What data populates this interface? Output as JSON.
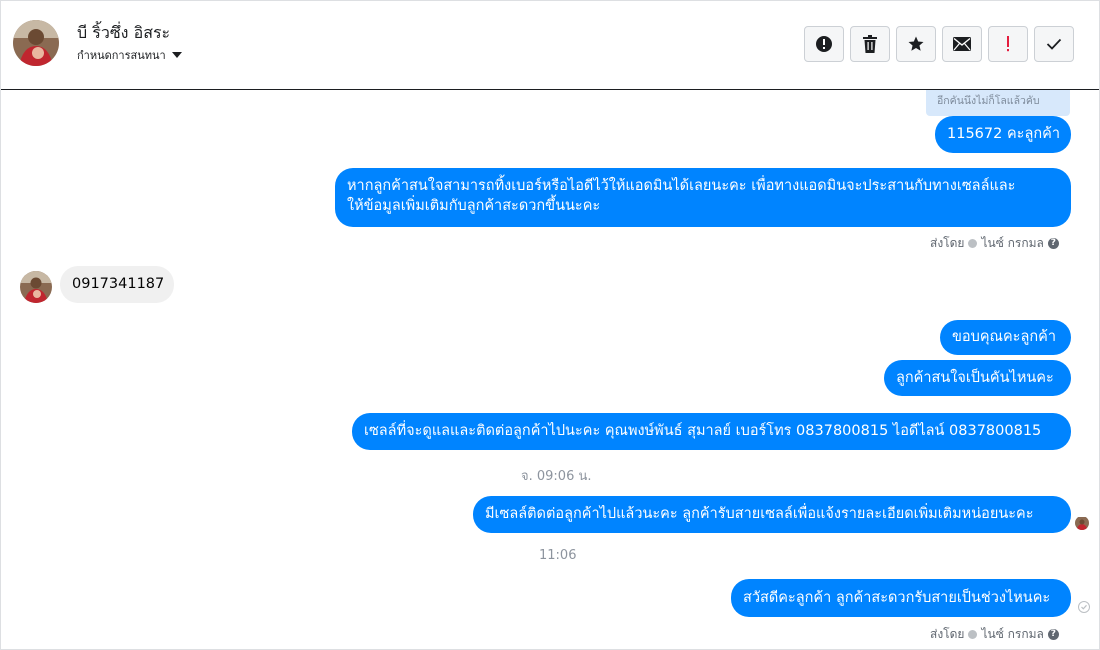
{
  "header": {
    "contact_name": "บี ริ้วซึ่ง อิสระ",
    "assign_label": "กำหนดการสนทนา",
    "toolbar": [
      {
        "name": "report-button",
        "icon": "alert-circle-icon"
      },
      {
        "name": "delete-button",
        "icon": "trash-icon"
      },
      {
        "name": "star-button",
        "icon": "star-icon"
      },
      {
        "name": "mark-unread-button",
        "icon": "envelope-icon"
      },
      {
        "name": "important-button",
        "icon": "exclamation-icon"
      },
      {
        "name": "done-button",
        "icon": "check-icon"
      }
    ]
  },
  "thread": {
    "faded_text": "อีกคันนึงไม่ก็โลแล้วคับ",
    "messages": [
      {
        "text": "115672 คะลูกค้า"
      },
      {
        "text_line1": "หากลูกค้าสนใจสามารถทิ้งเบอร์หรือไอดีไว้ให้แอดมินได้เลยนะคะ เพื่อทางแอดมินจะประสานกับทางเซลล์และ",
        "text_line2": "ให้ข้อมูลเพิ่มเติมกับลูกค้าสะดวกขึ้นนะคะ"
      },
      {
        "text": "0917341187"
      },
      {
        "text": "ขอบคุณคะลูกค้า"
      },
      {
        "text": "ลูกค้าสนใจเป็นคันไหนคะ"
      },
      {
        "text": "เซลล์ที่จะดูแลและติดต่อลูกค้าไปนะคะ คุณพงษ์พันธ์ สุมาลย์ เบอร์โทร 0837800815 ไอดีไลน์ 0837800815"
      },
      {
        "text": "มีเซลล์ติดต่อลูกค้าไปแล้วนะคะ ลูกค้ารับสายเซลล์เพื่อแจ้งรายละเอียดเพิ่มเติมหน่อยนะคะ"
      },
      {
        "text": "สวัสดีคะลูกค้า ลูกค้าสะดวกรับสายเป็นช่วงไหนคะ"
      }
    ],
    "sent_by_1": {
      "prefix": "ส่งโดย",
      "name": "ไนซ์ กรกมล"
    },
    "sent_by_2": {
      "prefix": "ส่งโดย",
      "name": "ไนซ์ กรกมล"
    },
    "timestamp_1": "จ. 09:06 น.",
    "timestamp_2": "11:06"
  },
  "colors": {
    "outgoing": "#0084ff",
    "incoming": "#f0f0f0",
    "text_meta": "#606770"
  }
}
